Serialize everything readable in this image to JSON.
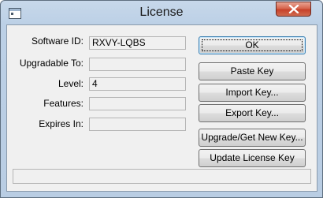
{
  "window": {
    "title": "License",
    "close_icon": "close-icon",
    "app_icon": "window-icon"
  },
  "form": {
    "software_id": {
      "label": "Software ID:",
      "value": "RXVY-LQBS"
    },
    "upgradable_to": {
      "label": "Upgradable To:",
      "value": ""
    },
    "level": {
      "label": "Level:",
      "value": "4"
    },
    "features": {
      "label": "Features:",
      "value": ""
    },
    "expires_in": {
      "label": "Expires In:",
      "value": ""
    }
  },
  "buttons": {
    "ok": "OK",
    "paste_key": "Paste Key",
    "import_key": "Import Key...",
    "export_key": "Export Key...",
    "upgrade_get_new_key": "Upgrade/Get New Key...",
    "update_license_key": "Update License Key"
  },
  "status": {
    "text": ""
  },
  "colors": {
    "close_button": "#c7412a",
    "title_bar": "#bcd0e6",
    "dialog_background": "#f0f0f0"
  }
}
